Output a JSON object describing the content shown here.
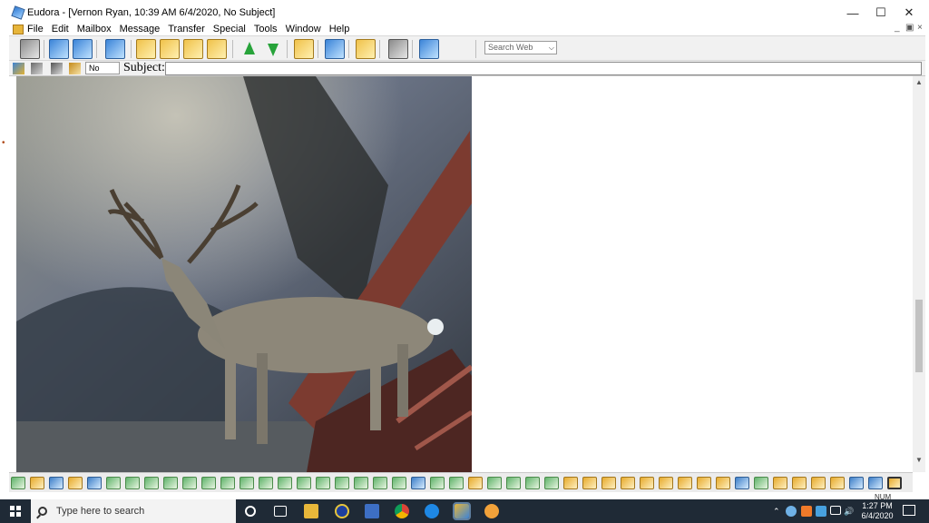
{
  "window": {
    "title": "Eudora - [Vernon Ryan, 10:39 AM 6/4/2020, No Subject]",
    "minimize_glyph": "—",
    "maximize_glyph": "☐",
    "close_glyph": "✕"
  },
  "menu": {
    "items": [
      "File",
      "Edit",
      "Mailbox",
      "Message",
      "Transfer",
      "Special",
      "Tools",
      "Window",
      "Help"
    ],
    "mdi_min": "_",
    "mdi_restore": "▣",
    "mdi_close": "×"
  },
  "toolbar": {
    "search_placeholder": "Search Web"
  },
  "subject_bar": {
    "priority": "No",
    "subject_label": "Subject:",
    "subject_value": ""
  },
  "body": {
    "image_description_icon": "photo-attachment-icon"
  },
  "status": {
    "num": "NUM"
  },
  "taskbar": {
    "search_placeholder": "Type here to search",
    "time": "1:27 PM",
    "date": "6/4/2020"
  },
  "colors": {
    "taskbar_bg": "#1f2a36",
    "toolbar_bg": "#f1f1f1",
    "accent_blue": "#3b84d8"
  }
}
